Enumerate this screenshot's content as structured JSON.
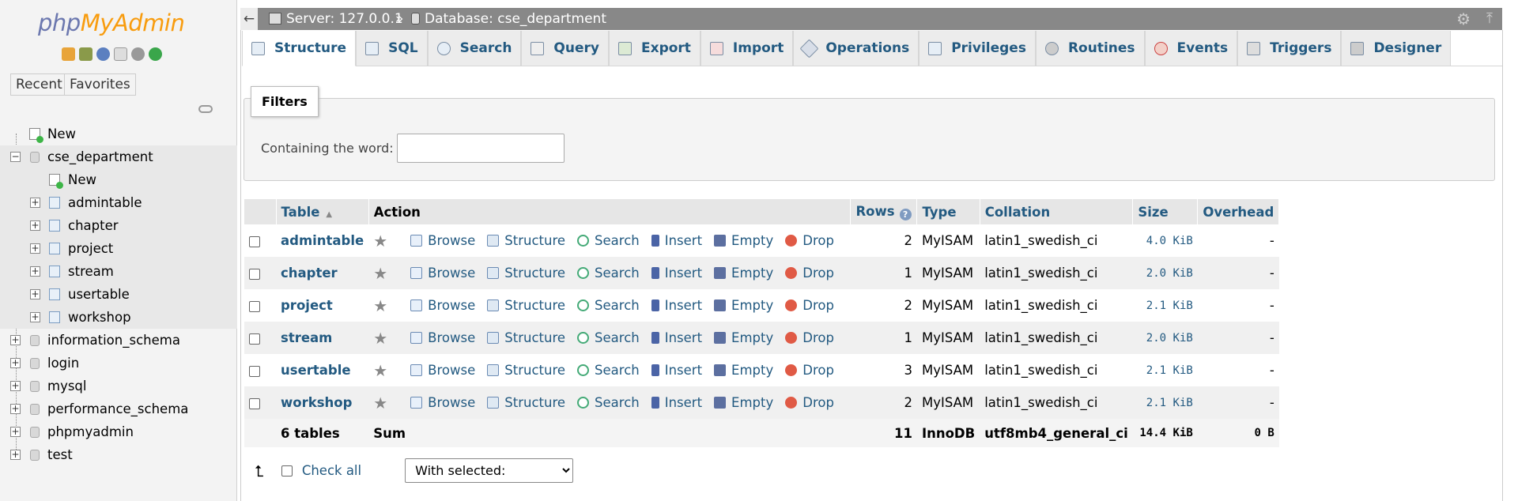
{
  "logo": {
    "part1": "php",
    "part2": "MyAdmin"
  },
  "nav": {
    "recent_label": "Recent",
    "favorites_label": "Favorites",
    "tree": [
      {
        "label": "New",
        "level": 0,
        "kind": "new"
      },
      {
        "label": "cse_department",
        "level": 0,
        "kind": "db",
        "expanded": true
      },
      {
        "label": "New",
        "level": 1,
        "kind": "new"
      },
      {
        "label": "admintable",
        "level": 1,
        "kind": "table"
      },
      {
        "label": "chapter",
        "level": 1,
        "kind": "table"
      },
      {
        "label": "project",
        "level": 1,
        "kind": "table"
      },
      {
        "label": "stream",
        "level": 1,
        "kind": "table"
      },
      {
        "label": "usertable",
        "level": 1,
        "kind": "table"
      },
      {
        "label": "workshop",
        "level": 1,
        "kind": "table"
      },
      {
        "label": "information_schema",
        "level": 0,
        "kind": "db"
      },
      {
        "label": "login",
        "level": 0,
        "kind": "db"
      },
      {
        "label": "mysql",
        "level": 0,
        "kind": "db"
      },
      {
        "label": "performance_schema",
        "level": 0,
        "kind": "db"
      },
      {
        "label": "phpmyadmin",
        "level": 0,
        "kind": "db"
      },
      {
        "label": "test",
        "level": 0,
        "kind": "db"
      }
    ]
  },
  "breadcrumb": {
    "server": "Server: 127.0.0.1",
    "separator": "»",
    "database": "Database: cse_department"
  },
  "tabs": [
    {
      "label": "Structure",
      "icon": "structure-icon",
      "active": true
    },
    {
      "label": "SQL",
      "icon": "sql-icon"
    },
    {
      "label": "Search",
      "icon": "search-icon"
    },
    {
      "label": "Query",
      "icon": "query-icon"
    },
    {
      "label": "Export",
      "icon": "export-icon"
    },
    {
      "label": "Import",
      "icon": "import-icon"
    },
    {
      "label": "Operations",
      "icon": "wrench-icon"
    },
    {
      "label": "Privileges",
      "icon": "privileges-icon"
    },
    {
      "label": "Routines",
      "icon": "routines-icon"
    },
    {
      "label": "Events",
      "icon": "events-clock-icon"
    },
    {
      "label": "Triggers",
      "icon": "triggers-icon"
    },
    {
      "label": "Designer",
      "icon": "designer-icon"
    }
  ],
  "filters": {
    "legend": "Filters",
    "label": "Containing the word:",
    "value": ""
  },
  "table": {
    "headers": {
      "table": "Table",
      "action": "Action",
      "rows": "Rows",
      "type": "Type",
      "collation": "Collation",
      "size": "Size",
      "overhead": "Overhead"
    },
    "actions": {
      "browse": "Browse",
      "structure": "Structure",
      "search": "Search",
      "insert": "Insert",
      "empty": "Empty",
      "drop": "Drop"
    },
    "rows": [
      {
        "name": "admintable",
        "rows": "2",
        "type": "MyISAM",
        "collation": "latin1_swedish_ci",
        "size": "4.0 KiB",
        "overhead": "-"
      },
      {
        "name": "chapter",
        "rows": "1",
        "type": "MyISAM",
        "collation": "latin1_swedish_ci",
        "size": "2.0 KiB",
        "overhead": "-"
      },
      {
        "name": "project",
        "rows": "2",
        "type": "MyISAM",
        "collation": "latin1_swedish_ci",
        "size": "2.1 KiB",
        "overhead": "-"
      },
      {
        "name": "stream",
        "rows": "1",
        "type": "MyISAM",
        "collation": "latin1_swedish_ci",
        "size": "2.0 KiB",
        "overhead": "-"
      },
      {
        "name": "usertable",
        "rows": "3",
        "type": "MyISAM",
        "collation": "latin1_swedish_ci",
        "size": "2.1 KiB",
        "overhead": "-"
      },
      {
        "name": "workshop",
        "rows": "2",
        "type": "MyISAM",
        "collation": "latin1_swedish_ci",
        "size": "2.1 KiB",
        "overhead": "-"
      }
    ],
    "footer": {
      "count": "6 tables",
      "sum": "Sum",
      "rows": "11",
      "type": "InnoDB",
      "collation": "utf8mb4_general_ci",
      "size": "14.4 KiB",
      "overhead": "0 B"
    }
  },
  "bottom": {
    "check_all": "Check all",
    "with_selected": "With selected:"
  }
}
